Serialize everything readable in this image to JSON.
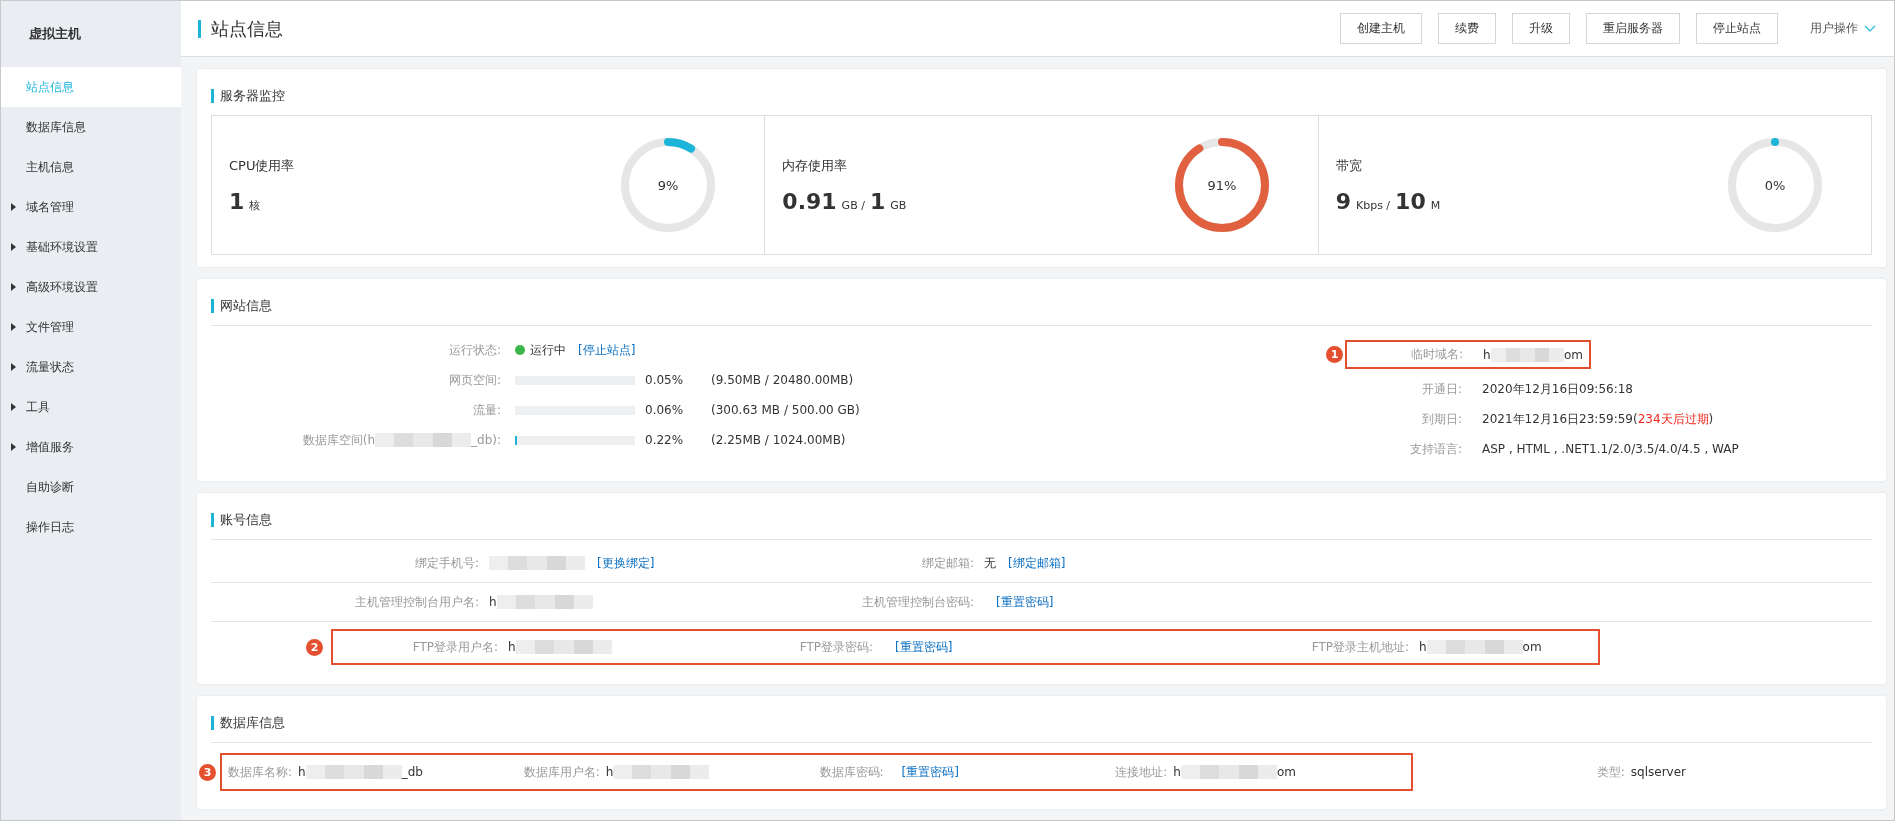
{
  "sidebar": {
    "title": "虚拟主机",
    "items": [
      {
        "label": "站点信息",
        "selected": true,
        "expandable": false
      },
      {
        "label": "数据库信息",
        "selected": false,
        "expandable": false
      },
      {
        "label": "主机信息",
        "selected": false,
        "expandable": false
      },
      {
        "label": "域名管理",
        "selected": false,
        "expandable": true
      },
      {
        "label": "基础环境设置",
        "selected": false,
        "expandable": true
      },
      {
        "label": "高级环境设置",
        "selected": false,
        "expandable": true
      },
      {
        "label": "文件管理",
        "selected": false,
        "expandable": true
      },
      {
        "label": "流量状态",
        "selected": false,
        "expandable": true
      },
      {
        "label": "工具",
        "selected": false,
        "expandable": true
      },
      {
        "label": "增值服务",
        "selected": false,
        "expandable": true
      },
      {
        "label": "自助诊断",
        "selected": false,
        "expandable": false
      },
      {
        "label": "操作日志",
        "selected": false,
        "expandable": false
      }
    ]
  },
  "header": {
    "title": "站点信息",
    "buttons": [
      "创建主机",
      "续费",
      "升级",
      "重启服务器",
      "停止站点"
    ],
    "user_menu": "用户操作"
  },
  "monitor": {
    "title": "服务器监控",
    "meters": [
      {
        "label": "CPU使用率",
        "parts": [
          {
            "kind": "number",
            "text": "1"
          },
          {
            "kind": "unit",
            "text": "核"
          }
        ],
        "level": 0.09,
        "reading": "9%",
        "color": "#1cb5d9"
      },
      {
        "label": "内存使用率",
        "parts": [
          {
            "kind": "number",
            "text": "0.91"
          },
          {
            "kind": "unit",
            "text": "GB /"
          },
          {
            "kind": "number",
            "text": "1"
          },
          {
            "kind": "unit",
            "text": "GB"
          }
        ],
        "level": 0.91,
        "reading": "91%",
        "color": "#e0603f"
      },
      {
        "label": "带宽",
        "parts": [
          {
            "kind": "number",
            "text": "9"
          },
          {
            "kind": "unit",
            "text": "Kbps /"
          },
          {
            "kind": "number",
            "text": "10"
          },
          {
            "kind": "unit",
            "text": "M"
          }
        ],
        "level": 0,
        "reading": "0%",
        "color": "#1cb5d9"
      }
    ]
  },
  "site": {
    "title": "网站信息",
    "left": [
      {
        "kind": "status",
        "label": "运行状态:",
        "status": "运行中",
        "link": "[停止站点]"
      },
      {
        "kind": "usage",
        "label": "网页空间:",
        "level": 0.0005,
        "percent": "0.05%",
        "detail": "(9.50MB / 20480.00MB)"
      },
      {
        "kind": "usage",
        "label": "流量:",
        "level": 0.0006,
        "percent": "0.06%",
        "detail": "(300.63 MB / 500.00 GB)"
      },
      {
        "kind": "usage",
        "label": "数据库空间(h",
        "label_end": "_db):",
        "masked": true,
        "level": 0.0022,
        "percent": "0.22%",
        "detail": "(2.25MB / 1024.00MB)"
      }
    ],
    "right": [
      {
        "label": "临时域名:",
        "value": "h",
        "value_end": "om",
        "masked": true,
        "callout": "1"
      },
      {
        "label": "开通日:",
        "value": "2020年12月16日09:56:18"
      },
      {
        "label": "到期日:",
        "value": "2021年12月16日23:59:59(",
        "alert": "234天后过期",
        "value_end": ")"
      },
      {
        "label": "支持语言:",
        "value": "ASP , HTML , .NET1.1/2.0/3.5/4.0/4.5 , WAP"
      }
    ]
  },
  "account": {
    "title": "账号信息",
    "rows": [
      {
        "fields": [
          {
            "label": "绑定手机号:",
            "masked": true,
            "link": "[更换绑定]"
          },
          {
            "label": "绑定邮箱:",
            "value": "无",
            "link": "[绑定邮箱]"
          }
        ]
      },
      {
        "fields": [
          {
            "label": "主机管理控制台用户名:",
            "value": "h",
            "masked": true
          },
          {
            "label": "主机管理控制台密码:",
            "link": "[重置密码]"
          }
        ]
      },
      {
        "callout": "2",
        "fields": [
          {
            "label": "FTP登录用户名:",
            "value": "h",
            "masked": true
          },
          {
            "label": "FTP登录密码:",
            "link": "[重置密码]"
          },
          {
            "label": "FTP登录主机地址:",
            "value": "h",
            "masked": true,
            "value_end": "om"
          }
        ]
      }
    ]
  },
  "database": {
    "title": "数据库信息",
    "callout": "3",
    "fields": [
      {
        "label": "数据库名称:",
        "value": "h",
        "masked": true,
        "value_end": "_db"
      },
      {
        "label": "数据库用户名:",
        "value": "h",
        "masked": true
      },
      {
        "label": "数据库密码:",
        "link": "[重置密码]"
      },
      {
        "label": "连接地址:",
        "value": "h",
        "masked": true,
        "value_end": "om"
      }
    ],
    "type": {
      "label": "类型:",
      "value": "sqlserver"
    }
  }
}
